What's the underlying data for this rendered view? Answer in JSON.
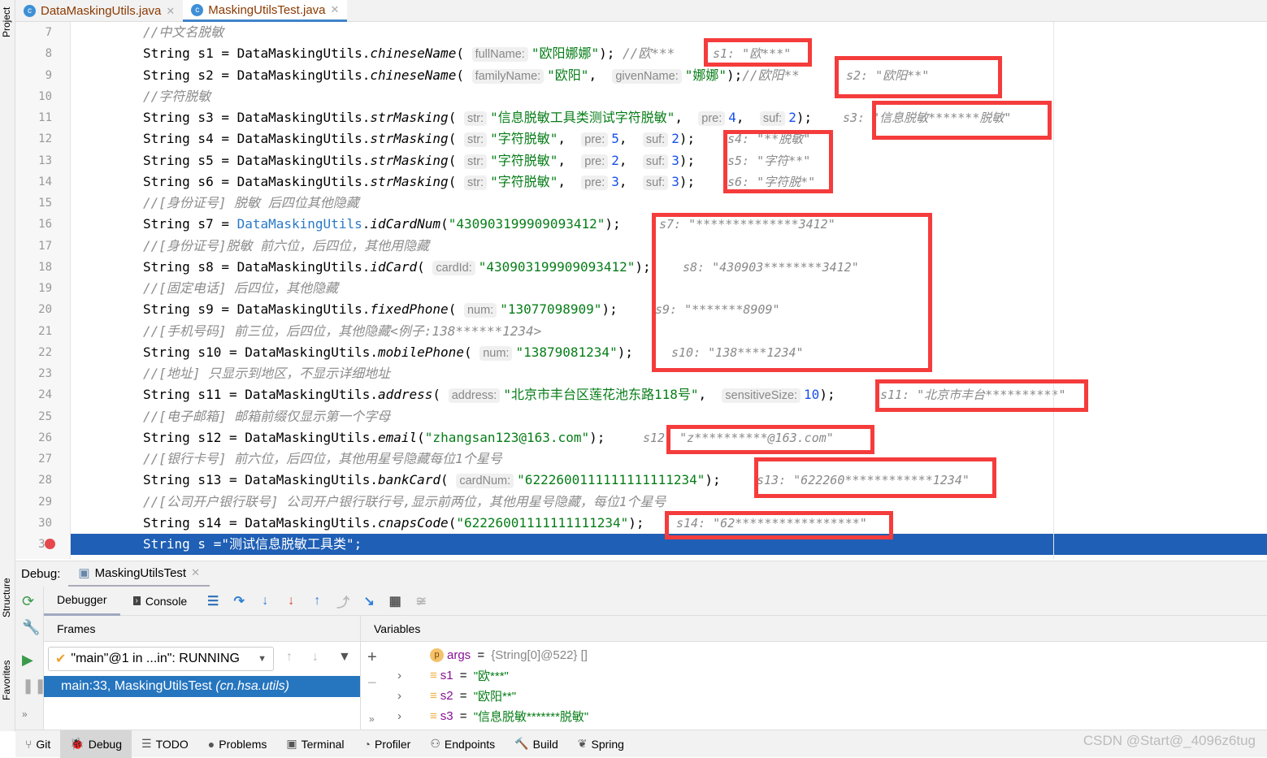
{
  "left_strip": {
    "project": "Project",
    "structure": "Structure",
    "favorites": "Favorites"
  },
  "tabs": [
    {
      "label": "DataMaskingUtils.java",
      "active": false
    },
    {
      "label": "MaskingUtilsTest.java",
      "active": true
    }
  ],
  "editor": {
    "first_line": 7,
    "breakpoint_line": 31,
    "current_line": 31,
    "lines": [
      [
        [
          "cm",
          "//中文名脱敏"
        ]
      ],
      [
        [
          "p",
          "String s1 = DataMaskingUtils."
        ],
        [
          "m",
          "chineseName"
        ],
        [
          "p",
          "( "
        ],
        [
          "h",
          "fullName:"
        ],
        [
          "s",
          "\"欧阳娜娜\""
        ],
        [
          "p",
          "); "
        ],
        [
          "cm",
          "//欧***"
        ]
      ],
      [
        [
          "p",
          "String s2 = DataMaskingUtils."
        ],
        [
          "m",
          "chineseName"
        ],
        [
          "p",
          "( "
        ],
        [
          "h",
          "familyName:"
        ],
        [
          "s",
          "\"欧阳\""
        ],
        [
          "p",
          ",  "
        ],
        [
          "h",
          "givenName:"
        ],
        [
          "s",
          "\"娜娜\""
        ],
        [
          "p",
          ");"
        ],
        [
          "cm",
          "//欧阳**"
        ]
      ],
      [
        [
          "cm",
          "//字符脱敏"
        ]
      ],
      [
        [
          "p",
          "String s3 = DataMaskingUtils."
        ],
        [
          "m",
          "strMasking"
        ],
        [
          "p",
          "( "
        ],
        [
          "h",
          "str:"
        ],
        [
          "s",
          "\"信息脱敏工具类测试字符脱敏\""
        ],
        [
          "p",
          ",  "
        ],
        [
          "h",
          "pre:"
        ],
        [
          "n",
          "4"
        ],
        [
          "p",
          ",  "
        ],
        [
          "h",
          "suf:"
        ],
        [
          "n",
          "2"
        ],
        [
          "p",
          ");"
        ]
      ],
      [
        [
          "p",
          "String s4 = DataMaskingUtils."
        ],
        [
          "m",
          "strMasking"
        ],
        [
          "p",
          "( "
        ],
        [
          "h",
          "str:"
        ],
        [
          "s",
          "\"字符脱敏\""
        ],
        [
          "p",
          ",  "
        ],
        [
          "h",
          "pre:"
        ],
        [
          "n",
          "5"
        ],
        [
          "p",
          ",  "
        ],
        [
          "h",
          "suf:"
        ],
        [
          "n",
          "2"
        ],
        [
          "p",
          ");"
        ]
      ],
      [
        [
          "p",
          "String s5 = DataMaskingUtils."
        ],
        [
          "m",
          "strMasking"
        ],
        [
          "p",
          "( "
        ],
        [
          "h",
          "str:"
        ],
        [
          "s",
          "\"字符脱敏\""
        ],
        [
          "p",
          ",  "
        ],
        [
          "h",
          "pre:"
        ],
        [
          "n",
          "2"
        ],
        [
          "p",
          ",  "
        ],
        [
          "h",
          "suf:"
        ],
        [
          "n",
          "3"
        ],
        [
          "p",
          ");"
        ]
      ],
      [
        [
          "p",
          "String s6 = DataMaskingUtils."
        ],
        [
          "m",
          "strMasking"
        ],
        [
          "p",
          "( "
        ],
        [
          "h",
          "str:"
        ],
        [
          "s",
          "\"字符脱敏\""
        ],
        [
          "p",
          ",  "
        ],
        [
          "h",
          "pre:"
        ],
        [
          "n",
          "3"
        ],
        [
          "p",
          ",  "
        ],
        [
          "h",
          "suf:"
        ],
        [
          "n",
          "3"
        ],
        [
          "p",
          ");"
        ]
      ],
      [
        [
          "cm",
          "//[身份证号] 脱敏 后四位其他隐藏"
        ]
      ],
      [
        [
          "p",
          "String s7 = "
        ],
        [
          "c",
          "DataMaskingUtils"
        ],
        [
          "p",
          "."
        ],
        [
          "m",
          "idCardNum"
        ],
        [
          "p",
          "("
        ],
        [
          "s",
          "\"430903199909093412\""
        ],
        [
          "p",
          ");"
        ]
      ],
      [
        [
          "cm",
          "//[身份证号]脱敏 前六位，后四位，其他用隐藏"
        ]
      ],
      [
        [
          "p",
          "String s8 = DataMaskingUtils."
        ],
        [
          "m",
          "idCard"
        ],
        [
          "p",
          "( "
        ],
        [
          "h",
          "cardId:"
        ],
        [
          "s",
          "\"430903199909093412\""
        ],
        [
          "p",
          ");"
        ]
      ],
      [
        [
          "cm",
          "//[固定电话] 后四位，其他隐藏"
        ]
      ],
      [
        [
          "p",
          "String s9 = DataMaskingUtils."
        ],
        [
          "m",
          "fixedPhone"
        ],
        [
          "p",
          "( "
        ],
        [
          "h",
          "num:"
        ],
        [
          "s",
          "\"13077098909\""
        ],
        [
          "p",
          ");"
        ]
      ],
      [
        [
          "cm",
          "//[手机号码] 前三位，后四位，其他隐藏<例子:138******1234>"
        ]
      ],
      [
        [
          "p",
          "String s10 = DataMaskingUtils."
        ],
        [
          "m",
          "mobilePhone"
        ],
        [
          "p",
          "( "
        ],
        [
          "h",
          "num:"
        ],
        [
          "s",
          "\"13879081234\""
        ],
        [
          "p",
          ");"
        ]
      ],
      [
        [
          "cm",
          "//[地址] 只显示到地区，不显示详细地址"
        ]
      ],
      [
        [
          "p",
          "String s11 = DataMaskingUtils."
        ],
        [
          "m",
          "address"
        ],
        [
          "p",
          "( "
        ],
        [
          "h",
          "address:"
        ],
        [
          "s",
          "\"北京市丰台区莲花池东路118号\""
        ],
        [
          "p",
          ",  "
        ],
        [
          "h",
          "sensitiveSize:"
        ],
        [
          "n",
          "10"
        ],
        [
          "p",
          ");"
        ]
      ],
      [
        [
          "cm",
          "//[电子邮箱] 邮箱前缀仅显示第一个字母"
        ]
      ],
      [
        [
          "p",
          "String s12 = DataMaskingUtils."
        ],
        [
          "m",
          "email"
        ],
        [
          "p",
          "("
        ],
        [
          "s",
          "\"zhangsan123@163.com\""
        ],
        [
          "p",
          ");"
        ]
      ],
      [
        [
          "cm",
          "//[银行卡号] 前六位，后四位，其他用星号隐藏每位1个星号"
        ]
      ],
      [
        [
          "p",
          "String s13 = DataMaskingUtils."
        ],
        [
          "m",
          "bankCard"
        ],
        [
          "p",
          "( "
        ],
        [
          "h",
          "cardNum:"
        ],
        [
          "s",
          "\"6222600111111111111234\""
        ],
        [
          "p",
          ");"
        ]
      ],
      [
        [
          "cm",
          "//[公司开户银行联号] 公司开户银行联行号,显示前两位，其他用星号隐藏，每位1个星号"
        ]
      ],
      [
        [
          "p",
          "String s14 = DataMaskingUtils."
        ],
        [
          "m",
          "cnapsCode"
        ],
        [
          "p",
          "("
        ],
        [
          "s",
          "\"62226001111111111234\""
        ],
        [
          "p",
          ");"
        ]
      ],
      [
        [
          "p",
          "String s =\"测试信息脱敏工具类\";"
        ]
      ]
    ],
    "inline_values": {
      "8": "s1: \"欧***\"",
      "9": "s2: \"欧阳**\"",
      "11": "s3: \"信息脱敏*******脱敏\"",
      "12": "s4: \"**脱敏\"",
      "13": "s5: \"字符**\"",
      "14": "s6: \"字符脱*\"",
      "16": "s7: \"**************3412\"",
      "18": "s8: \"430903********3412\"",
      "20": "s9: \"*******8909\"",
      "22": "s10: \"138****1234\"",
      "24": "s11: \"北京市丰台**********\"",
      "26": "s12: \"z**********@163.com\"",
      "28": "s13: \"622260************1234\"",
      "30": "s14: \"62*****************\""
    }
  },
  "debug": {
    "label": "Debug:",
    "session": "MaskingUtilsTest",
    "tabs": {
      "debugger": "Debugger",
      "console": "Console"
    },
    "frames_title": "Frames",
    "variables_title": "Variables",
    "thread": "\"main\"@1 in ...in\": RUNNING",
    "frame": "main:33, MaskingUtilsTest",
    "frame_pkg": "(cn.hsa.utils)",
    "variables": [
      {
        "name": "args",
        "eq": " = ",
        "val": "{String[0]@522} []",
        "icon": "p"
      },
      {
        "name": "s1",
        "eq": " = ",
        "val": "\"欧***\"",
        "icon": "field"
      },
      {
        "name": "s2",
        "eq": " = ",
        "val": "\"欧阳**\"",
        "icon": "field"
      },
      {
        "name": "s3",
        "eq": " = ",
        "val": "\"信息脱敏*******脱敏\"",
        "icon": "field"
      }
    ]
  },
  "bottom_tabs": [
    "Git",
    "Debug",
    "TODO",
    "Problems",
    "Terminal",
    "Profiler",
    "Endpoints",
    "Build",
    "Spring"
  ],
  "bottom_active": "Debug",
  "watermark": "CSDN @Start@_4096z6tug",
  "colors": {
    "highlight_line": "#1f5fb5",
    "red_box": "#f53c3c",
    "string": "#067d17",
    "number": "#1750eb"
  }
}
